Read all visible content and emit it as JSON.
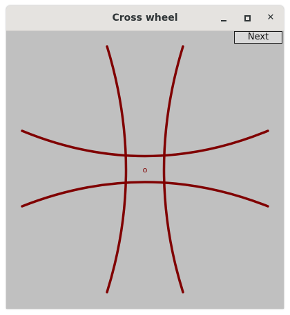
{
  "window": {
    "title": "Cross wheel",
    "controls": {
      "minimize": "minimize-icon",
      "maximize": "maximize-icon",
      "close": "close-icon",
      "close_glyph": "✕"
    }
  },
  "toolbar": {
    "next_label": "Next"
  },
  "canvas": {
    "center_label": "o",
    "curve_color": "#800000",
    "background": "#c0c0c0"
  }
}
